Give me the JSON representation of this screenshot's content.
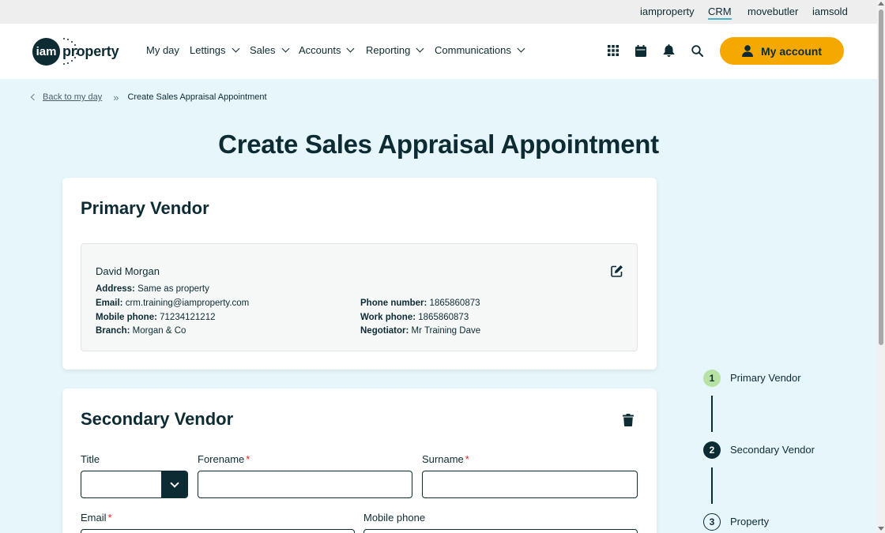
{
  "utility_links": [
    {
      "label": "iamproperty",
      "active": false
    },
    {
      "label": "CRM",
      "active": true
    },
    {
      "label": "movebutler",
      "active": false
    },
    {
      "label": "iamsold",
      "active": false
    }
  ],
  "logo": {
    "mark": "iam",
    "text": "property"
  },
  "nav": [
    {
      "label": "My day",
      "dropdown": false
    },
    {
      "label": "Lettings",
      "dropdown": true
    },
    {
      "label": "Sales",
      "dropdown": true
    },
    {
      "label": "Accounts",
      "dropdown": true
    },
    {
      "label": "Reporting",
      "dropdown": true
    },
    {
      "label": "Communications",
      "dropdown": true
    }
  ],
  "header_icons": [
    "apps-grid-icon",
    "calendar-icon",
    "bell-icon",
    "search-icon"
  ],
  "my_account": {
    "label": "My account",
    "color": "#f5a800"
  },
  "breadcrumb": {
    "back_label": "Back to my day",
    "separator": "»",
    "current": "Create Sales Appraisal Appointment"
  },
  "page_title": "Create Sales Appraisal Appointment",
  "primary_vendor": {
    "title": "Primary Vendor",
    "name": "David Morgan",
    "address_label": "Address:",
    "address": "Same as property",
    "email_label": "Email:",
    "email": "crm.training@iamproperty.com",
    "mobile_label": "Mobile phone:",
    "mobile": "71234121212",
    "branch_label": "Branch:",
    "branch": "Morgan & Co",
    "phone_label": "Phone number:",
    "phone": "1865860873",
    "work_label": "Work phone:",
    "work": "1865860873",
    "negotiator_label": "Negotiator:",
    "negotiator": "Mr Training Dave"
  },
  "secondary_vendor": {
    "title": "Secondary Vendor",
    "title_label": "Title",
    "title_value": "",
    "forename_label": "Forename",
    "surname_label": "Surname",
    "email_label": "Email",
    "mobile_label": "Mobile phone",
    "required_mark": "*"
  },
  "stepper": [
    {
      "number": "1",
      "label": "Primary Vendor",
      "state": "complete"
    },
    {
      "number": "2",
      "label": "Secondary Vendor",
      "state": "current"
    },
    {
      "number": "3",
      "label": "Property",
      "state": "upcoming"
    }
  ],
  "colors": {
    "brand_dark": "#0d2b33",
    "accent": "#f5a800",
    "page_bg": "#e6f6fa",
    "step_complete": "#b7e2a3",
    "required": "#e2231a"
  }
}
